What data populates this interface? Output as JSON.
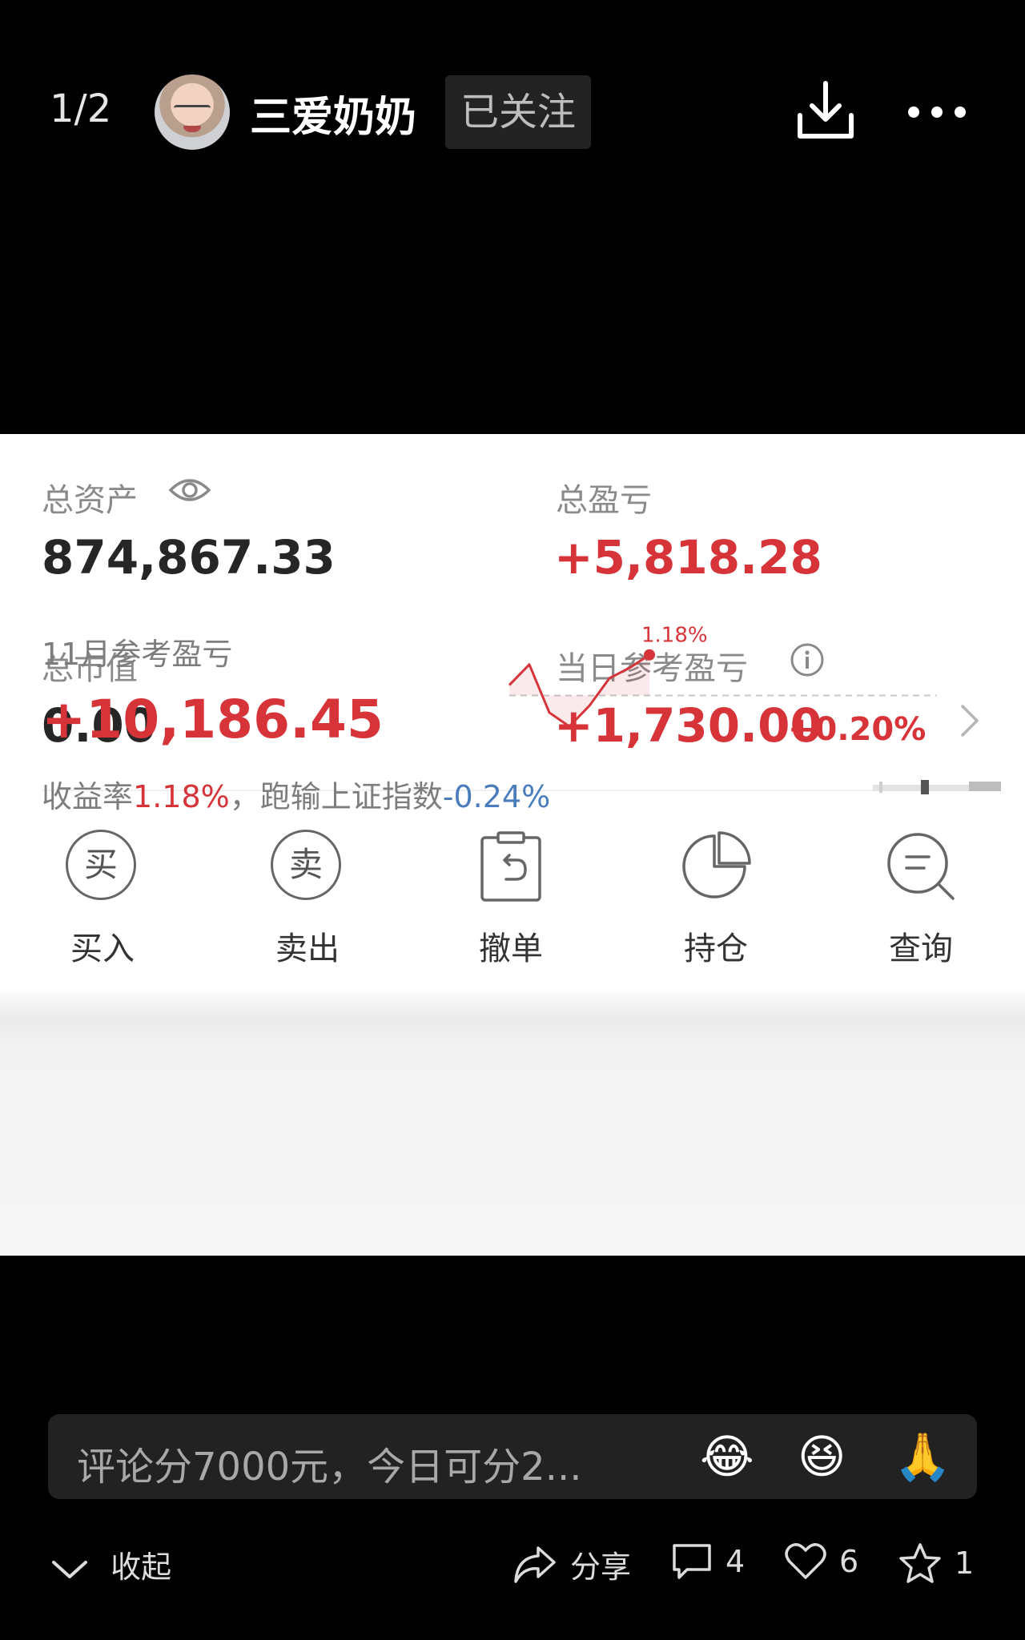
{
  "header": {
    "page_indicator": "1/2",
    "author": "三爱奶奶",
    "follow_label": "已关注"
  },
  "account": {
    "total_assets_label": "总资产",
    "total_assets": "874,867.33",
    "total_pnl_label": "总盈亏",
    "total_pnl": "+5,818.28",
    "market_value_label": "总市值",
    "market_value": "0.00",
    "daily_pnl_label": "当日参考盈亏",
    "daily_pnl": "+1,730.00",
    "daily_pct": "+0.20%"
  },
  "actions": [
    {
      "icon_char": "买",
      "label": "买入"
    },
    {
      "icon_char": "卖",
      "label": "卖出"
    },
    {
      "label": "撤单"
    },
    {
      "label": "持仓"
    },
    {
      "label": "查询"
    }
  ],
  "monthly": {
    "label": "11月参考盈亏",
    "value": "+10,186.45",
    "ret_prefix": "收益率",
    "ret_value": "1.18%",
    "ret_mid": "，跑输上证指数",
    "index_diff": "-0.24%",
    "peak_label": "1.18%"
  },
  "chart_data": {
    "type": "line",
    "values": [
      0.3,
      0.9,
      -0.5,
      -0.9,
      -0.3,
      0.5,
      0.8,
      1.18
    ],
    "baseline": 0
  },
  "colors": {
    "up": "#d7343a",
    "down": "#4b7dbd"
  },
  "comment": {
    "text": "评论分7000元，今日可分2...",
    "emojis": [
      "😂",
      "😆",
      "🙏"
    ]
  },
  "bottom": {
    "collapse_label": "收起",
    "share_label": "分享",
    "comment_count": "4",
    "like_count": "6",
    "star_count": "1"
  }
}
